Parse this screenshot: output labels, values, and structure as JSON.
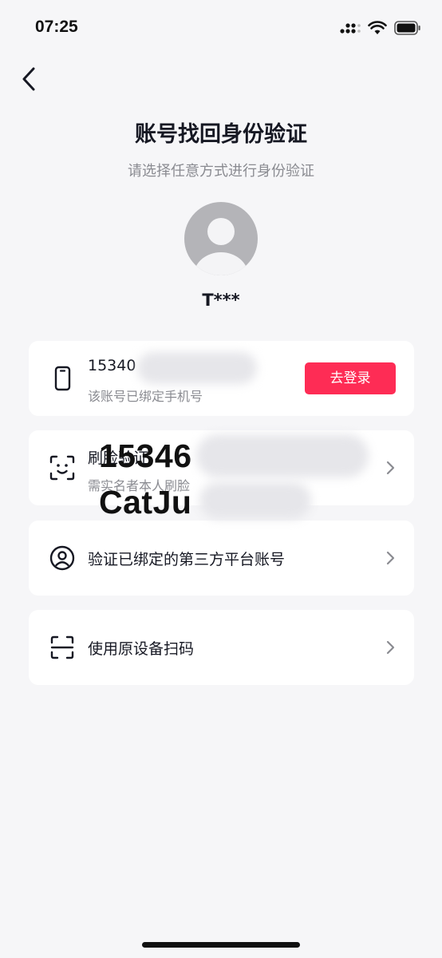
{
  "status_bar": {
    "time": "07:25"
  },
  "header": {
    "title": "账号找回身份验证",
    "subtitle": "请选择任意方式进行身份验证"
  },
  "account": {
    "username": "T***"
  },
  "options": [
    {
      "label": "15340",
      "sub": "该账号已绑定手机号",
      "icon": "phone-icon",
      "action_label": "去登录"
    },
    {
      "label": "刷脸验证",
      "sub": "需实名者本人刷脸",
      "icon": "face-scan-icon"
    },
    {
      "label": "验证已绑定的第三方平台账号",
      "icon": "user-circle-icon"
    },
    {
      "label": "使用原设备扫码",
      "icon": "scan-code-icon"
    }
  ],
  "overlay": {
    "line1": "15346",
    "line2": "CatJu"
  },
  "colors": {
    "accent": "#fe2c55",
    "background": "#f6f6f8",
    "card": "#ffffff"
  }
}
